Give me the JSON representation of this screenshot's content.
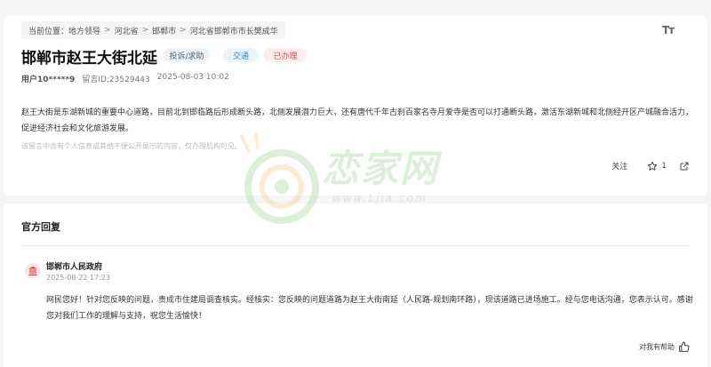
{
  "breadcrumb": {
    "prefix": "当前位置：",
    "items": [
      "地方领导",
      "河北省",
      "邯郸市",
      "河北省邯郸市市长樊成华"
    ],
    "separator": ">"
  },
  "font_toggle_label": "Tт",
  "post": {
    "title": "邯郸市赵王大街北延",
    "tags": {
      "category": "投诉/求助",
      "type": "交通",
      "status": "已办理"
    },
    "user": "用户10*****9",
    "message_id": "留言ID:23529443",
    "date": "2025-08-03 10:02",
    "content": "赵王大街是东湖新城的重要中心道路，目前北到邯临路后形成断头路，北侧发展潜力巨大，还有唐代千年古刹百家名寺月爱寺是否可以打通断头路，激活东湖新城和北侧经开区产城融合活力，促进经济社会和文化旅游发展。",
    "notice": "该留言中含有个人信息或其他不便公开展示的内容，仅办理机构可见。",
    "follow_label": "关注",
    "star_count": "1"
  },
  "watermark": {
    "text": "恋家网",
    "url": "www.Ljia.com"
  },
  "reply": {
    "section_title": "官方回复",
    "org": "邯郸市人民政府",
    "time": "2025-08-22 17:23",
    "text": "网民您好！针对您反映的问题，责成市住建局调查核实。经核实：您反映的问题道路为赵王大街南延（人民路-规划南环路），现该道路已进场施工。经与您电话沟通，您表示认可。感谢您对我们工作的理解与支持，祝您生活愉快！",
    "helpful_label": "对我有帮助"
  },
  "colors": {
    "status_red": "#e04a4a",
    "type_blue": "#3a8cc7",
    "accent_red": "#d9412f"
  }
}
